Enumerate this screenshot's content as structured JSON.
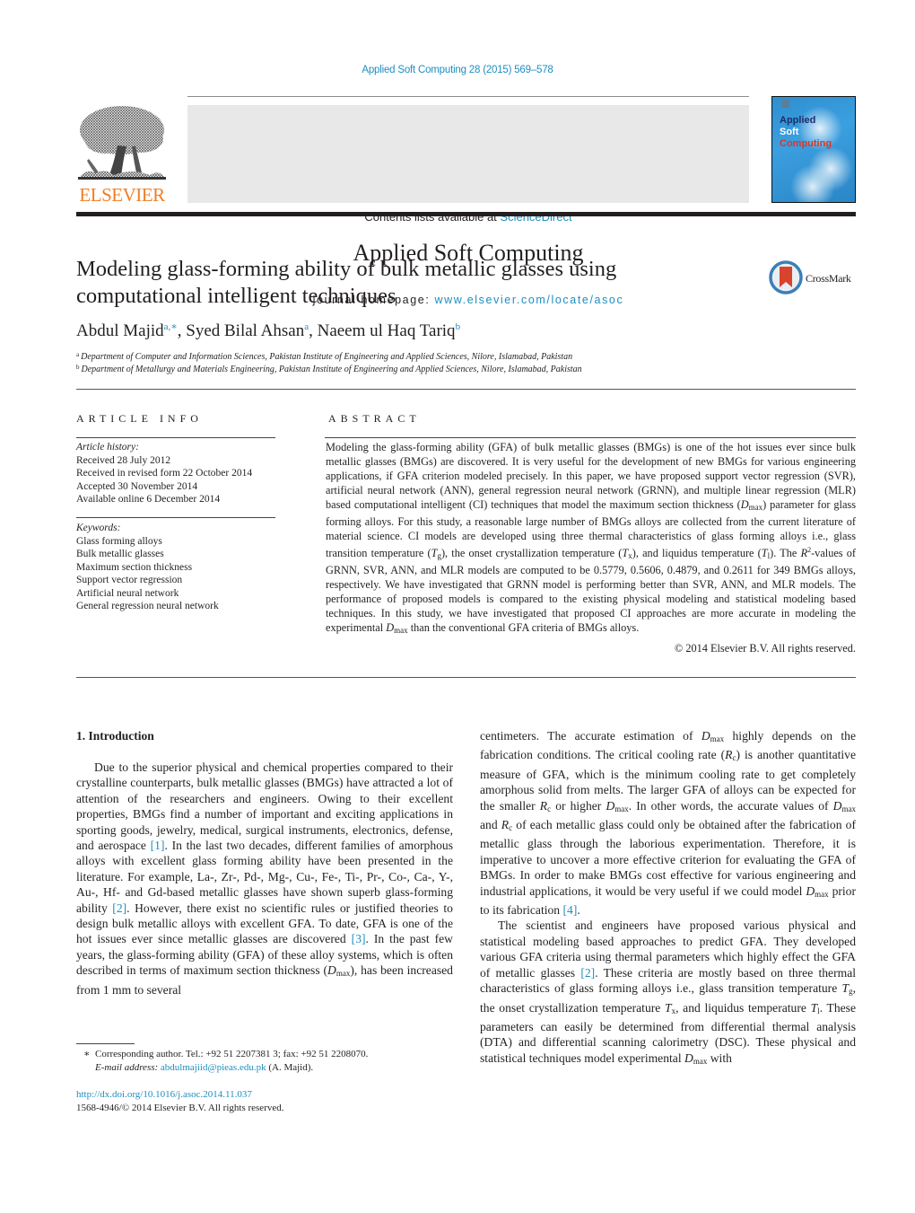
{
  "header": {
    "citation": "Applied Soft Computing 28 (2015) 569–578",
    "contents_prefix": "Contents lists available at ",
    "contents_link": "ScienceDirect",
    "journal_name": "Applied Soft Computing",
    "homepage_prefix": "journal homepage: ",
    "homepage_link": "www.elsevier.com/locate/asoc",
    "publisher_logo_text": "ELSEVIER",
    "cover": {
      "line1": "Applied",
      "line2": "Soft",
      "line3": "Computing"
    },
    "colors": {
      "link": "#1f8dbf",
      "elsevier_orange": "#f07e26",
      "cover_blue": "#2f8fcf",
      "cover_red": "#d7372b"
    }
  },
  "article": {
    "title": "Modeling glass-forming ability of bulk metallic glasses using computational intelligent techniques",
    "crossmark_label": "CrossMark",
    "authors": [
      {
        "name": "Abdul Majid",
        "affil": "a,∗"
      },
      {
        "name": "Syed Bilal Ahsan",
        "affil": "a"
      },
      {
        "name": "Naeem ul Haq Tariq",
        "affil": "b"
      }
    ],
    "affiliations": [
      {
        "mark": "a",
        "text": "Department of Computer and Information Sciences, Pakistan Institute of Engineering and Applied Sciences, Nilore, Islamabad, Pakistan"
      },
      {
        "mark": "b",
        "text": "Department of Metallurgy and Materials Engineering, Pakistan Institute of Engineering and Applied Sciences, Nilore, Islamabad, Pakistan"
      }
    ]
  },
  "article_info": {
    "label": "ARTICLE INFO",
    "history_heading": "Article history:",
    "history": [
      "Received 28 July 2012",
      "Received in revised form 22 October 2014",
      "Accepted 30 November 2014",
      "Available online 6 December 2014"
    ],
    "keywords_heading": "Keywords:",
    "keywords": [
      "Glass forming alloys",
      "Bulk metallic glasses",
      "Maximum section thickness",
      "Support vector regression",
      "Artificial neural network",
      "General regression neural network"
    ]
  },
  "abstract": {
    "label": "ABSTRACT",
    "s1": "Modeling the glass-forming ability (GFA) of bulk metallic glasses (BMGs) is one of the hot issues ever since bulk metallic glasses (BMGs) are discovered. It is very useful for the development of new BMGs for various engineering applications, if GFA criterion modeled precisely. In this paper, we have proposed support vector regression (SVR), artificial neural network (ANN), general regression neural network (GRNN), and multiple linear regression (MLR) based computational intelligent (CI) techniques that model the maximum section thickness (",
    "s2": ") parameter for glass forming alloys. For this study, a reasonable large number of BMGs alloys are collected from the current literature of material science. CI models are developed using three thermal characteristics of glass forming alloys i.e., glass transition temperature (",
    "s3": "), the onset crystallization temperature (",
    "s4": "), and liquidus temperature (",
    "s5": "). The ",
    "s6": "-values of GRNN, SVR, ANN, and MLR models are computed to be 0.5779, 0.5606, 0.4879, and 0.2611 for 349 BMGs alloys, respectively. We have investigated that GRNN model is performing better than SVR, ANN, and MLR models. The performance of proposed models is compared to the existing physical modeling and statistical modeling based techniques. In this study, we have investigated that proposed CI approaches are more accurate in modeling the experimental ",
    "s7": " than the conventional GFA criteria of BMGs alloys.",
    "copyright": "© 2014 Elsevier B.V. All rights reserved."
  },
  "symbols": {
    "D": "D",
    "max": "max",
    "T": "T",
    "g": "g",
    "x": "x",
    "l": "l",
    "R": "R",
    "c": "c",
    "R2": "R",
    "two": "2"
  },
  "introduction": {
    "heading": "1.  Introduction",
    "left": {
      "p1a": "Due to the superior physical and chemical properties compared to their crystalline counterparts, bulk metallic glasses (BMGs) have attracted a lot of attention of the researchers and engineers. Owing to their excellent properties, BMGs find a number of important and exciting applications in sporting goods, jewelry, medical, surgical instruments, electronics, defense, and aerospace ",
      "ref1": "[1]",
      "p1b": ". In the last two decades, different families of amorphous alloys with excellent glass forming ability have been presented in the literature. For example, La-, Zr-, Pd-, Mg-, Cu-, Fe-, Ti-, Pr-, Co-, Ca-, Y-, Au-, Hf- and Gd-based metallic glasses have shown superb glass-forming ability ",
      "ref2": "[2]",
      "p1c": ". However, there exist no scientific rules or justified theories to design bulk metallic alloys with excellent GFA. To date, GFA is one of the hot issues ever since metallic glasses are discovered ",
      "ref3": "[3]",
      "p1d": ". In the past few years, the glass-forming ability (GFA) of these alloy systems, which is often described in terms of maximum section thickness (",
      "p1e": "), has been increased from 1 mm to several"
    },
    "right": {
      "p1a": "centimeters. The accurate estimation of ",
      "p1b": " highly depends on the fabrication conditions. The critical cooling rate (",
      "p1c": ") is another quantitative measure of GFA, which is the minimum cooling rate to get completely amorphous solid from melts. The larger GFA of alloys can be expected for the smaller ",
      "p1d": " or higher ",
      "p1e": ". In other words, the accurate values of ",
      "p1f": " and ",
      "p1g": " of each metallic glass could only be obtained after the fabrication of metallic glass through the laborious experimentation. Therefore, it is imperative to uncover a more effective criterion for evaluating the GFA of BMGs. In order to make BMGs cost effective for various engineering and industrial applications, it would be very useful if we could model ",
      "p1h": " prior to its fabrication ",
      "ref4": "[4]",
      "p1i": ".",
      "p2a": "The scientist and engineers have proposed various physical and statistical modeling based approaches to predict GFA. They developed various GFA criteria using thermal parameters which highly effect the GFA of metallic glasses ",
      "ref2": "[2]",
      "p2b": ". These criteria are mostly based on three thermal characteristics of glass forming alloys i.e., glass transition temperature ",
      "p2c": ", the onset crystallization temperature ",
      "p2d": ", and liquidus temperature ",
      "p2e": ". These parameters can easily be determined from differential thermal analysis (DTA) and differential scanning calorimetry (DSC). These physical and statistical techniques model experimental ",
      "p2f": " with"
    }
  },
  "footnote": {
    "star": "∗",
    "corresponding": "Corresponding author. Tel.: +92 51 2207381 3; fax: +92 51 2208070.",
    "email_label": "E-mail address: ",
    "email": "abdulmajiid@pieas.edu.pk",
    "email_suffix": " (A. Majid).",
    "doi": "http://dx.doi.org/10.1016/j.asoc.2014.11.037",
    "issn": "1568-4946/© 2014 Elsevier B.V. All rights reserved."
  }
}
